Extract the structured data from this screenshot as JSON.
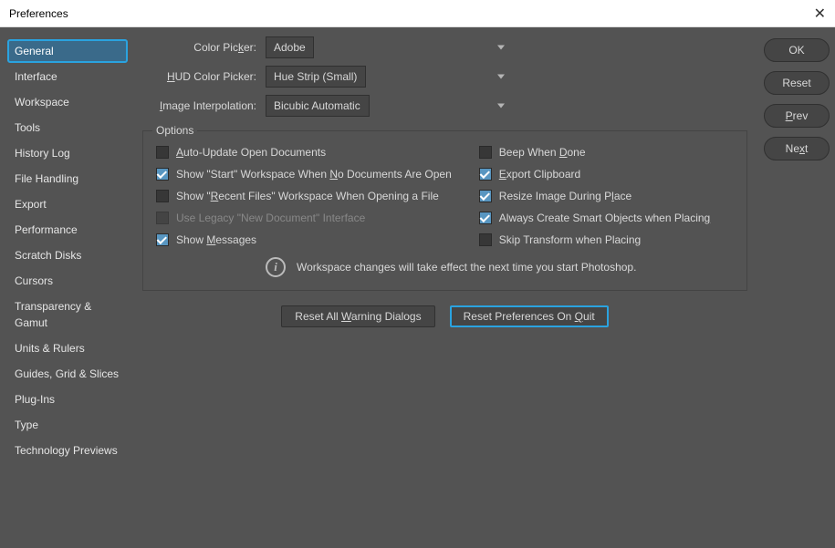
{
  "title": "Preferences",
  "sidebar": {
    "items": [
      {
        "label": "General",
        "active": true
      },
      {
        "label": "Interface"
      },
      {
        "label": "Workspace"
      },
      {
        "label": "Tools"
      },
      {
        "label": "History Log"
      },
      {
        "label": "File Handling"
      },
      {
        "label": "Export"
      },
      {
        "label": "Performance"
      },
      {
        "label": "Scratch Disks"
      },
      {
        "label": "Cursors"
      },
      {
        "label": "Transparency & Gamut"
      },
      {
        "label": "Units & Rulers"
      },
      {
        "label": "Guides, Grid & Slices"
      },
      {
        "label": "Plug-Ins"
      },
      {
        "label": "Type"
      },
      {
        "label": "Technology Previews"
      }
    ]
  },
  "selects": {
    "color_picker": {
      "label_pre": "Color Pic",
      "label_u": "k",
      "label_post": "er:",
      "value": "Adobe"
    },
    "hud": {
      "label_pre": "",
      "label_u": "H",
      "label_post": "UD Color Picker:",
      "value": "Hue Strip (Small)"
    },
    "interp": {
      "label_pre": "",
      "label_u": "I",
      "label_post": "mage Interpolation:",
      "value": "Bicubic Automatic"
    }
  },
  "options": {
    "legend": "Options",
    "left": [
      {
        "pre": "",
        "u": "A",
        "post": "uto-Update Open Documents",
        "checked": false,
        "disabled": false
      },
      {
        "pre": "Show \"Start\" Workspace When ",
        "u": "N",
        "post": "o Documents Are Open",
        "checked": true,
        "disabled": false
      },
      {
        "pre": "Show \"",
        "u": "R",
        "post": "ecent Files\" Workspace When Opening a File",
        "checked": false,
        "disabled": false
      },
      {
        "pre": "Use Legacy \"New Document\" Interface",
        "u": "",
        "post": "",
        "checked": false,
        "disabled": true
      },
      {
        "pre": "Show ",
        "u": "M",
        "post": "essages",
        "checked": true,
        "disabled": false
      }
    ],
    "right": [
      {
        "pre": "Beep When ",
        "u": "D",
        "post": "one",
        "checked": false,
        "disabled": false
      },
      {
        "pre": "",
        "u": "E",
        "post": "xport Clipboard",
        "checked": true,
        "disabled": false
      },
      {
        "pre": "Resize Image During P",
        "u": "l",
        "post": "ace",
        "checked": true,
        "disabled": false
      },
      {
        "pre": "Always Create Smart Objects when Placin",
        "u": "g",
        "post": "",
        "checked": true,
        "disabled": false
      },
      {
        "pre": "Skip Transform when Placing",
        "u": "",
        "post": "",
        "checked": false,
        "disabled": false
      }
    ]
  },
  "info": "Workspace changes will take effect the next time you start Photoshop.",
  "reset_buttons": {
    "warning": {
      "pre": "Reset All ",
      "u": "W",
      "post": "arning Dialogs"
    },
    "onquit": {
      "pre": "Reset Preferences On ",
      "u": "Q",
      "post": "uit"
    }
  },
  "rightbar": {
    "ok": "OK",
    "reset": "Reset",
    "prev": {
      "u": "P",
      "post": "rev"
    },
    "next": {
      "pre": "Ne",
      "u": "x",
      "post": "t"
    }
  }
}
